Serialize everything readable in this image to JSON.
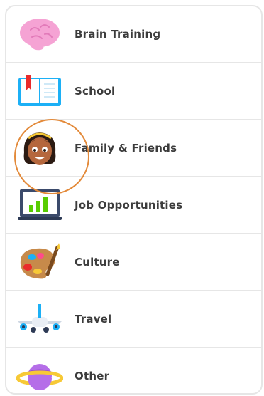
{
  "options": [
    {
      "id": "brain",
      "label": "Brain Training",
      "icon": "brain-icon"
    },
    {
      "id": "school",
      "label": "School",
      "icon": "book-icon"
    },
    {
      "id": "family",
      "label": "Family & Friends",
      "icon": "girl-face-icon"
    },
    {
      "id": "job",
      "label": "Job Opportunities",
      "icon": "chart-monitor-icon"
    },
    {
      "id": "culture",
      "label": "Culture",
      "icon": "paint-palette-icon"
    },
    {
      "id": "travel",
      "label": "Travel",
      "icon": "airplane-icon"
    },
    {
      "id": "other",
      "label": "Other",
      "icon": "planet-icon"
    }
  ],
  "highlight": {
    "option": "family",
    "color": "#e38a3a"
  }
}
